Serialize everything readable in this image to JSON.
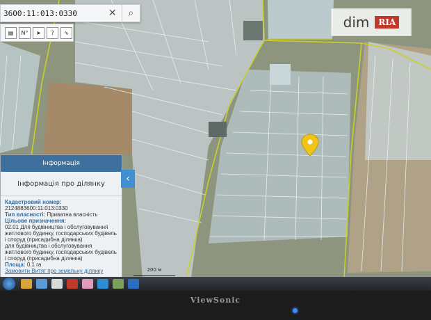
{
  "search": {
    "value": "3600:11:013:0330"
  },
  "toolbar": {
    "ruler_label": "N°"
  },
  "logo": {
    "brand": "dim",
    "tag": "RIA"
  },
  "panel": {
    "header": "Інформація",
    "subtitle": "Інформація про ділянку",
    "cadastral_label": "Кадастровий номер:",
    "cadastral_value": "2124883600:11:013:0330",
    "ownership_label": "Тип власності:",
    "ownership_value": "Приватна власність",
    "purpose_label": "Цільове призначення:",
    "purpose_value": "02.01 Для будівництва і обслуговування житлового будинку, господарських будівель і споруд (присадибна ділянка)",
    "purpose_detail": "для будівництва і обслуговування житлового будинку, господарських будівель і споруд (присадибна ділянка)",
    "area_label": "Площа:",
    "area_value": "0.1 га",
    "order_link": "Замовити Витяг про земельну ділянку"
  },
  "map": {
    "scale_label": "200 м"
  },
  "monitor": {
    "brand": "ViewSonic"
  },
  "colors": {
    "header": "#3f6f9c",
    "boundary": "#c8d02a",
    "pin": "#f0c419",
    "parcel": "#cfe1ea"
  }
}
